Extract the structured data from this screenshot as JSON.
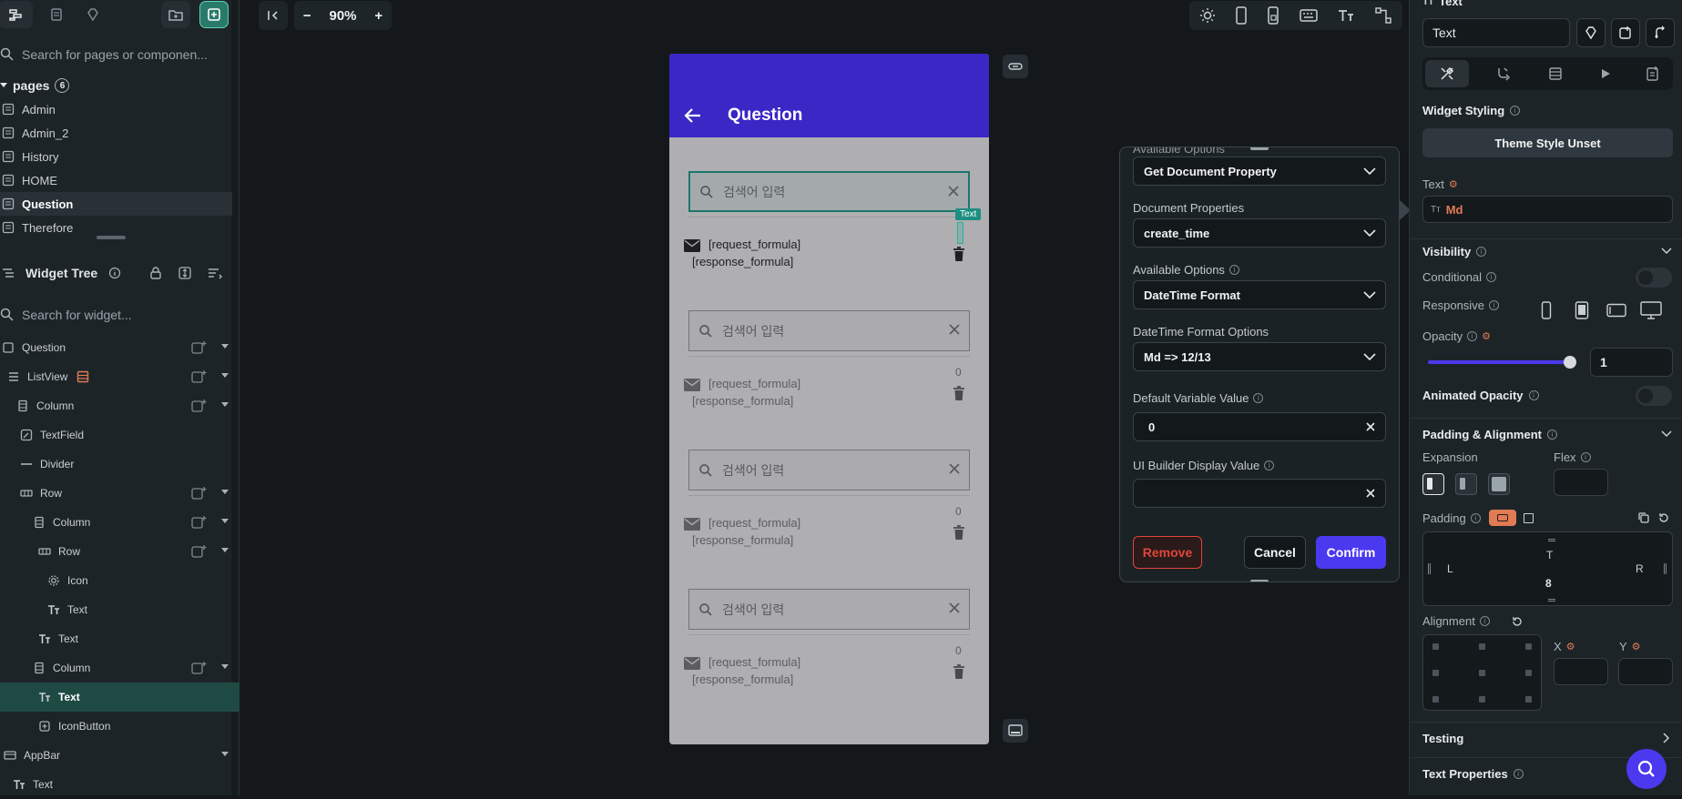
{
  "left_panel": {
    "search_pages_placeholder": "Search for pages or componen...",
    "pages_label": "pages",
    "pages_count": "6",
    "pages": [
      "Admin",
      "Admin_2",
      "History",
      "HOME",
      "Question",
      "Therefore"
    ],
    "selected_page": "Question",
    "widget_tree_label": "Widget Tree",
    "search_widget_placeholder": "Search for widget...",
    "tree": [
      {
        "label": "Question",
        "icon": "page-icon"
      },
      {
        "label": "ListView",
        "icon": "list-icon"
      },
      {
        "label": "Column",
        "icon": "column-icon"
      },
      {
        "label": "TextField",
        "icon": "textfield-icon"
      },
      {
        "label": "Divider",
        "icon": "divider-icon"
      },
      {
        "label": "Row",
        "icon": "row-icon"
      },
      {
        "label": "Column",
        "icon": "column-icon"
      },
      {
        "label": "Row",
        "icon": "row-icon"
      },
      {
        "label": "Icon",
        "icon": "gear-icon"
      },
      {
        "label": "Text",
        "icon": "text-icon"
      },
      {
        "label": "Text",
        "icon": "text-icon"
      },
      {
        "label": "Column",
        "icon": "column-icon"
      },
      {
        "label": "Text",
        "icon": "text-icon"
      },
      {
        "label": "IconButton",
        "icon": "iconbutton-icon"
      },
      {
        "label": "AppBar",
        "icon": "appbar-icon"
      },
      {
        "label": "Text",
        "icon": "text-icon"
      }
    ]
  },
  "toolbar": {
    "zoom_minus": "−",
    "zoom_value": "90%",
    "zoom_plus": "+"
  },
  "phone": {
    "title": "Question",
    "search_placeholder": "검색어 입력",
    "line1": "[request_formula]",
    "line2": "[response_formula]",
    "zero": "0",
    "selected_tag": "Text"
  },
  "popup": {
    "cut_label": "Available Options",
    "source_value": "Get Document Property",
    "doc_props_label": "Document Properties",
    "doc_props_value": "create_time",
    "available_options_label": "Available Options",
    "available_options_value": "DateTime Format",
    "datetime_options_label": "DateTime Format Options",
    "datetime_options_value": "Md => 12/13",
    "default_value_label": "Default Variable Value",
    "default_value": "0",
    "display_value_label": "UI Builder Display Value",
    "display_value": "",
    "remove_label": "Remove",
    "cancel_label": "Cancel",
    "confirm_label": "Confirm"
  },
  "right_panel": {
    "header_label": "Text",
    "name_value": "Text",
    "widget_styling_label": "Widget Styling",
    "theme_style_label": "Theme Style Unset",
    "text_label": "Text",
    "text_value": "Md",
    "visibility_label": "Visibility",
    "conditional_label": "Conditional",
    "responsive_label": "Responsive",
    "opacity_label": "Opacity",
    "opacity_value": "1",
    "opacity_fraction": 1.0,
    "animated_opacity_label": "Animated Opacity",
    "padding_alignment_label": "Padding & Alignment",
    "expansion_label": "Expansion",
    "flex_label": "Flex",
    "padding_label": "Padding",
    "pad_T": "T",
    "pad_L": "L",
    "pad_R": "R",
    "pad_B_value": "8",
    "alignment_label": "Alignment",
    "x_label": "X",
    "y_label": "Y",
    "testing_label": "Testing",
    "text_properties_label": "Text Properties"
  },
  "colors": {
    "accent": "#3a27c5",
    "teal": "#1d8f82",
    "remove": "#e0453b",
    "confirm": "#4b39ef",
    "orange": "#e07b54"
  }
}
